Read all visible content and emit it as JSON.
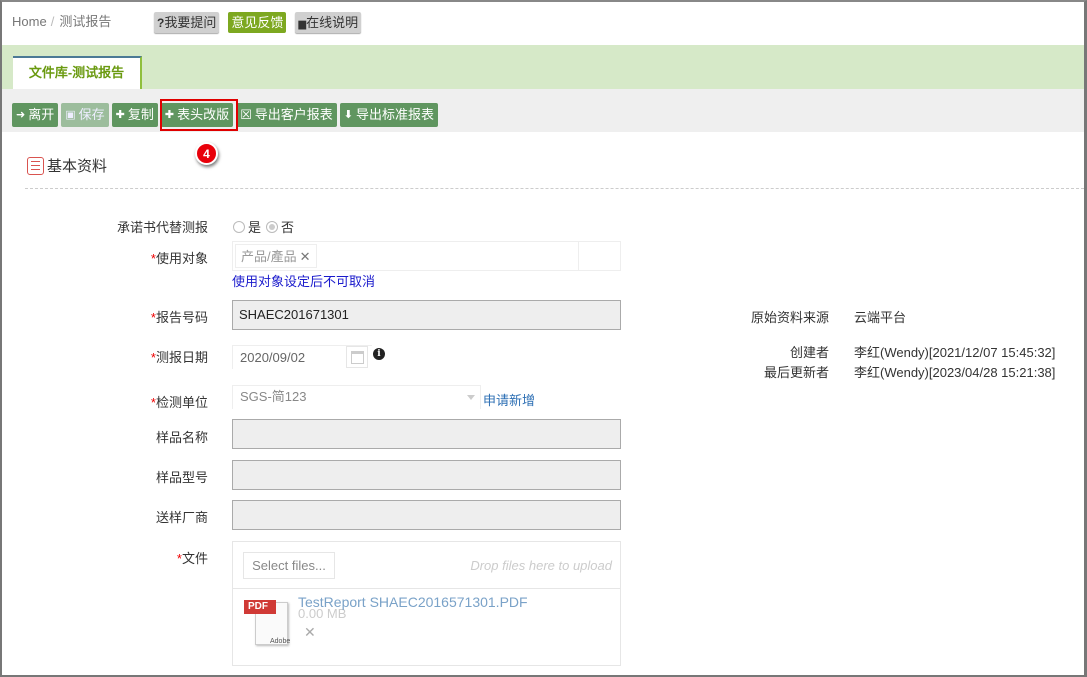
{
  "breadcrumb": {
    "home": "Home",
    "separator": "/",
    "current": "测试报告"
  },
  "top_links": [
    {
      "icon": "question-icon",
      "icon_glyph": "?",
      "label": "我要提问"
    },
    {
      "label": "意见反馈"
    },
    {
      "icon": "book-icon",
      "icon_glyph": "▆",
      "label": "在线说明"
    }
  ],
  "tab": {
    "label": "文件库-测试报告"
  },
  "toolbar": {
    "buttons": [
      {
        "icon": "exit-icon",
        "icon_glyph": "➜",
        "label": "离开",
        "disabled": false
      },
      {
        "icon": "save-icon",
        "icon_glyph": "▣",
        "label": "保存",
        "disabled": true
      },
      {
        "icon": "plus-icon",
        "icon_glyph": "✚",
        "label": "复制",
        "disabled": false
      },
      {
        "icon": "plus-icon",
        "icon_glyph": "✚",
        "label": "表头改版",
        "disabled": false
      },
      {
        "icon": "excel-icon",
        "icon_glyph": "☒",
        "label": "导出客户报表",
        "disabled": false
      },
      {
        "icon": "download-icon",
        "icon_glyph": "⬇",
        "label": "导出标准报表",
        "disabled": false
      }
    ]
  },
  "annotation_badge": "4",
  "section": {
    "title": "基本资料",
    "icon": "list-icon"
  },
  "form": {
    "commitment": {
      "label": "承诺书代替测报",
      "options": [
        "是",
        "否"
      ],
      "selected": "否"
    },
    "target": {
      "label": "使用对象",
      "required": true,
      "chip": "产品/產品",
      "chip_remove": "✕",
      "hint": "使用对象设定后不可取消"
    },
    "report_no": {
      "label": "报告号码",
      "required": true,
      "value": "SHAEC201671301"
    },
    "test_date": {
      "label": "测报日期",
      "required": true,
      "value": "2020/09/02",
      "info": "i"
    },
    "test_unit": {
      "label": "检测单位",
      "required": true,
      "value": "SGS-简123",
      "apply_link": "申请新增"
    },
    "sample_name": {
      "label": "样品名称",
      "value": ""
    },
    "sample_model": {
      "label": "样品型号",
      "value": ""
    },
    "vendor": {
      "label": "送样厂商",
      "value": ""
    },
    "file": {
      "label": "文件",
      "required": true,
      "select_button": "Select files...",
      "drop_hint": "Drop files here to upload",
      "pdf_tag": "PDF",
      "pdf_brand": "Adobe",
      "file_name": "TestReport  SHAEC2016571301.PDF",
      "file_size": "0.00 MB",
      "remove": "✕"
    }
  },
  "meta": {
    "source": {
      "label": "原始资料来源",
      "value": "云端平台"
    },
    "creator": {
      "label": "创建者",
      "value": "李红(Wendy)[2021/12/07 15:45:32]"
    },
    "updater": {
      "label": "最后更新者",
      "value": "李红(Wendy)[2023/04/28 15:21:38]"
    }
  }
}
